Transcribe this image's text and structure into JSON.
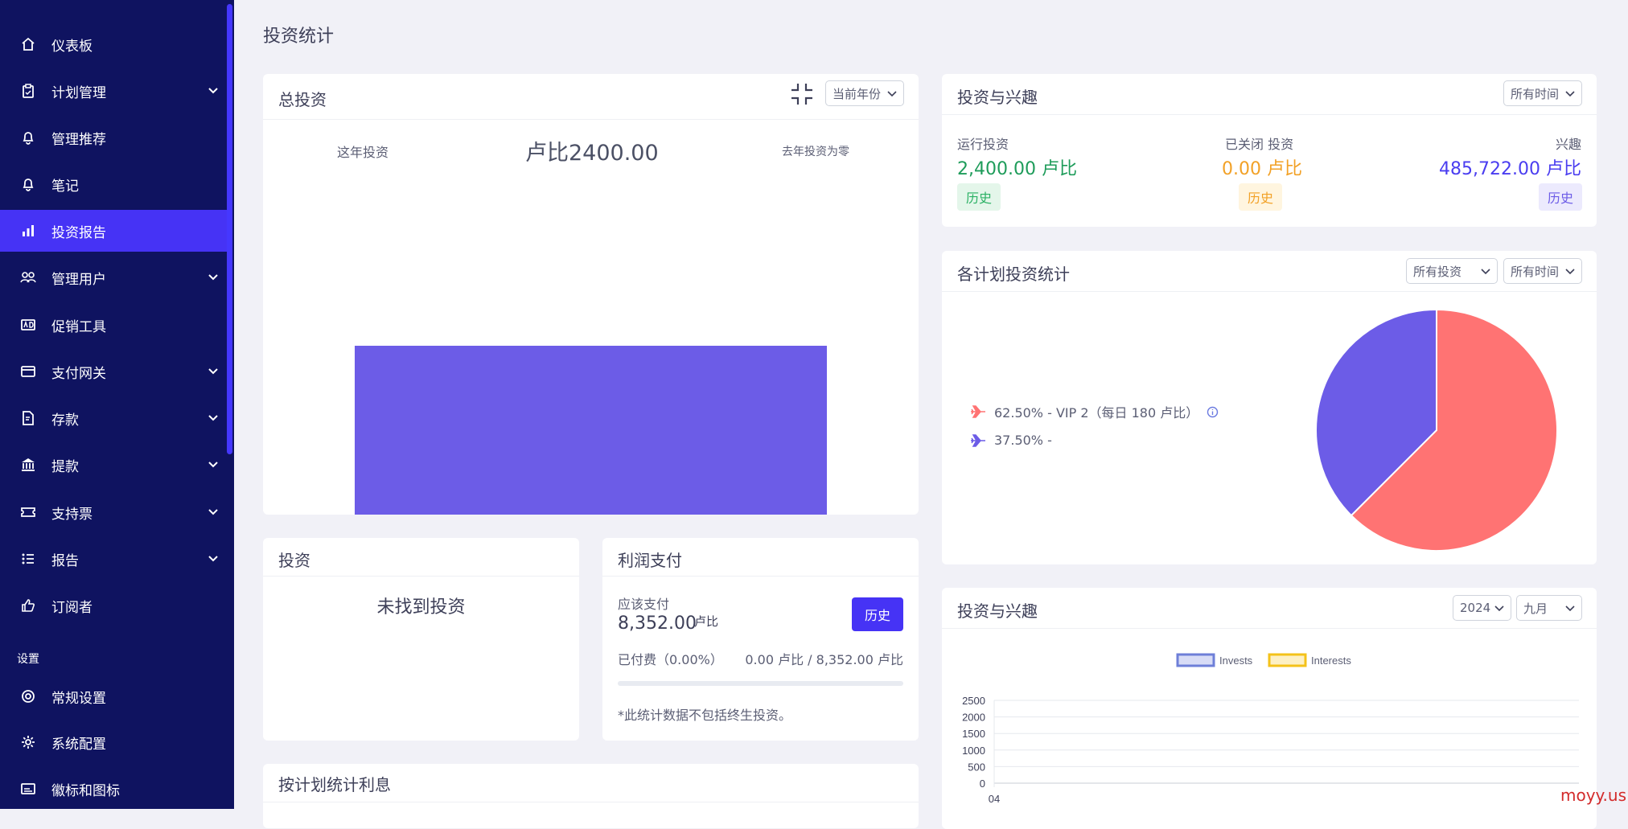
{
  "sidebar": {
    "items": [
      {
        "label": "仪表板",
        "icon": "home-icon"
      },
      {
        "label": "计划管理",
        "icon": "clipboard-icon"
      },
      {
        "label": "管理推荐",
        "icon": "bell-icon"
      },
      {
        "label": "笔记",
        "icon": "bell-icon"
      },
      {
        "label": "投资报告",
        "icon": "bar-chart-icon"
      },
      {
        "label": "管理用户",
        "icon": "users-icon"
      },
      {
        "label": "促销工具",
        "icon": "ad-icon"
      },
      {
        "label": "支付网关",
        "icon": "credit-card-icon"
      },
      {
        "label": "存款",
        "icon": "deposit-icon"
      },
      {
        "label": "提款",
        "icon": "bank-icon"
      },
      {
        "label": "支持票",
        "icon": "ticket-icon"
      },
      {
        "label": "报告",
        "icon": "list-icon"
      },
      {
        "label": "订阅者",
        "icon": "thumbs-up-icon"
      }
    ],
    "section_label": "设置",
    "settings_items": [
      {
        "label": "常规设置",
        "icon": "life-ring-icon"
      },
      {
        "label": "系统配置",
        "icon": "gear-icon"
      },
      {
        "label": "徽标和图标",
        "icon": "image-icon"
      }
    ]
  },
  "page_title": "投资统计",
  "total_investment": {
    "title": "总投资",
    "period_select": "当前年份",
    "this_year_label": "这年投资",
    "amount": "卢比2400.00",
    "last_year_note": "去年投资为零"
  },
  "invest_interest_top": {
    "title": "投资与兴趣",
    "time_select": "所有时间",
    "running_label": "运行投资",
    "running_value": "2,400.00 卢比",
    "closed_label": "已关闭 投资",
    "closed_value": "0.00 卢比",
    "interest_label": "兴趣",
    "interest_value": "485,722.00 卢比",
    "history_label": "历史",
    "colors": {
      "running": "#1e9c5a",
      "closed": "#f2a126",
      "interest": "#4a3df0"
    }
  },
  "plan_stats": {
    "title": "各计划投资统计",
    "invest_select": "所有投资",
    "time_select": "所有时间",
    "legend": [
      {
        "text": "62.50% - VIP 2（每日 180 卢比）",
        "color": "#ff7373"
      },
      {
        "text": "37.50% -",
        "color": "#6c5ce7"
      }
    ]
  },
  "investment_card": {
    "title": "投资",
    "empty_text": "未找到投资"
  },
  "profit_card": {
    "title": "利润支付",
    "due_label": "应该支付",
    "due_value": "8,352.00",
    "due_unit": "卢比",
    "history_button": "历史",
    "paid_label": "已付费（0.00%）",
    "paid_value": "0.00 卢比 / 8,352.00 卢比",
    "progress": 0.0,
    "note": "*此统计数据不包括终生投资。"
  },
  "plan_interest_card": {
    "title": "按计划统计利息"
  },
  "invest_interest_chart": {
    "title": "投资与兴趣",
    "year_select": "2024",
    "month_select": "九月"
  },
  "chart_data": [
    {
      "type": "bar",
      "categories": [
        ""
      ],
      "values": [
        2400
      ],
      "color": "#6c5ce7"
    },
    {
      "type": "pie",
      "labels": [
        "VIP 2（每日 180 卢比）",
        ""
      ],
      "values": [
        62.5,
        37.5
      ],
      "colors": [
        "#ff7373",
        "#6c5ce7"
      ]
    },
    {
      "type": "line",
      "x": [
        "04"
      ],
      "series": [
        {
          "name": "Invests",
          "values": [
            0
          ],
          "color": "#6e7fd8"
        },
        {
          "name": "Interests",
          "values": [
            0
          ],
          "color": "#f4c21a"
        }
      ],
      "yticks": [
        "2500",
        "2000",
        "1500",
        "1000",
        "500",
        "0"
      ],
      "ylim": [
        0,
        2500
      ],
      "legend_position": "top"
    }
  ],
  "watermark": "moyy.us"
}
